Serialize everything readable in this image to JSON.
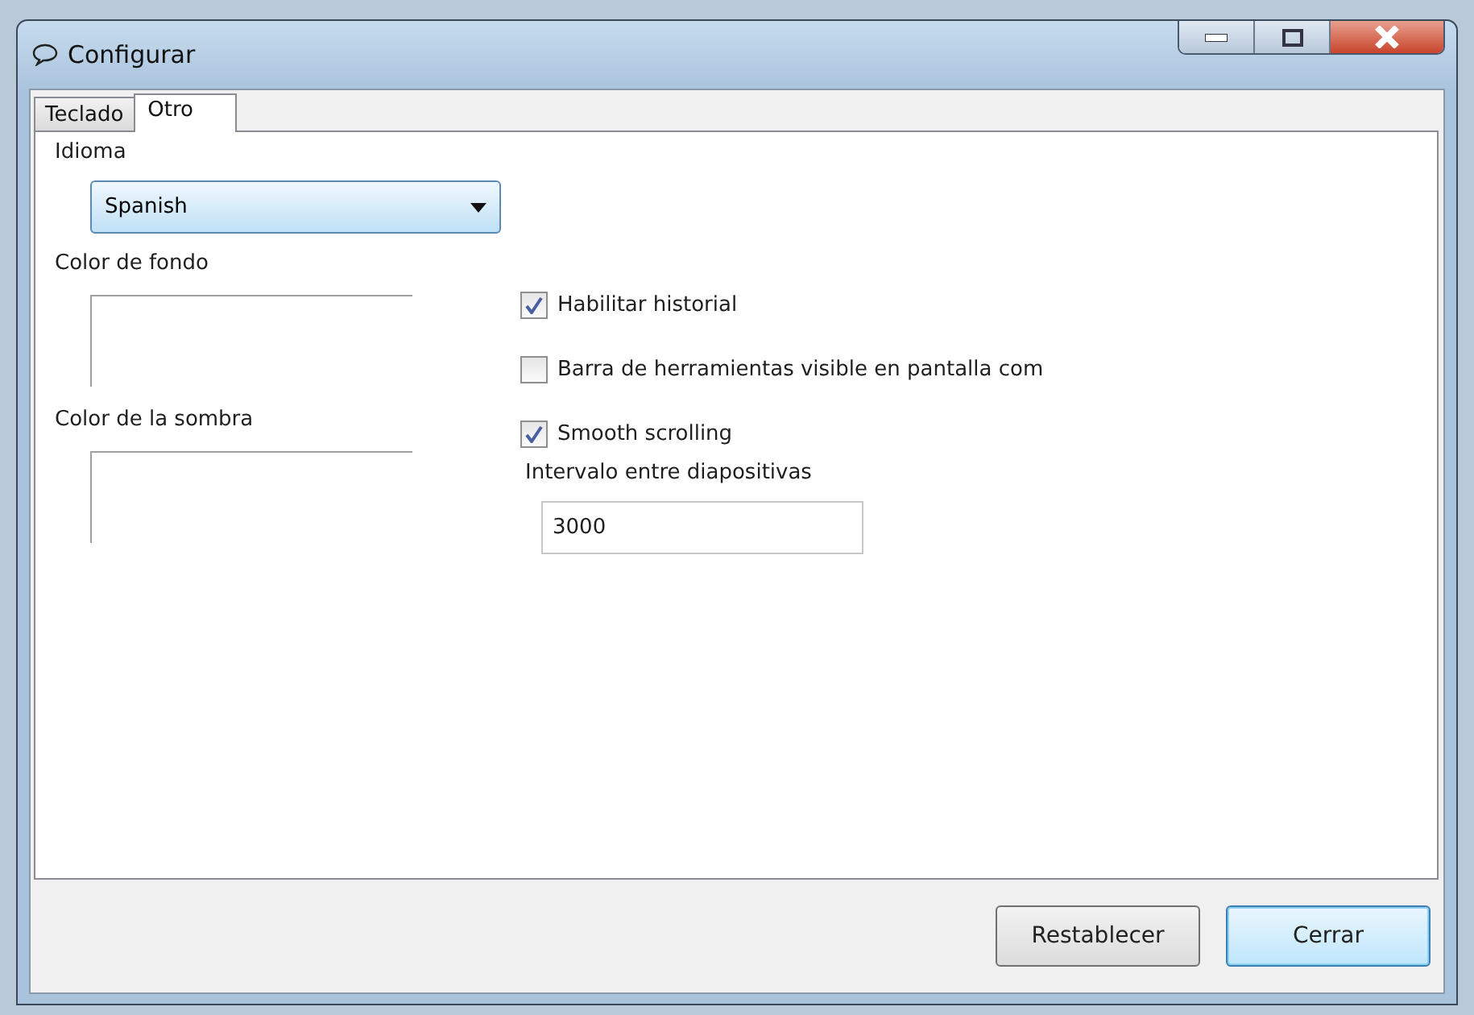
{
  "window": {
    "title": "Configurar"
  },
  "tabs": [
    {
      "label": "Teclado",
      "selected": false
    },
    {
      "label": "Otro",
      "selected": true
    }
  ],
  "language": {
    "label": "Idioma",
    "value": "Spanish"
  },
  "colors": [
    {
      "label": "Color de fondo"
    },
    {
      "label": "Color de la sombra"
    }
  ],
  "options": [
    {
      "label": "Habilitar historial",
      "checked": true
    },
    {
      "label": "Barra de herramientas visible en pantalla com",
      "checked": false
    },
    {
      "label": "Smooth scrolling",
      "checked": true
    }
  ],
  "interval": {
    "label": "Intervalo entre diapositivas",
    "value": "3000"
  },
  "buttons": [
    {
      "label": "Restablecer",
      "default": false
    },
    {
      "label": "Cerrar",
      "default": true
    }
  ]
}
